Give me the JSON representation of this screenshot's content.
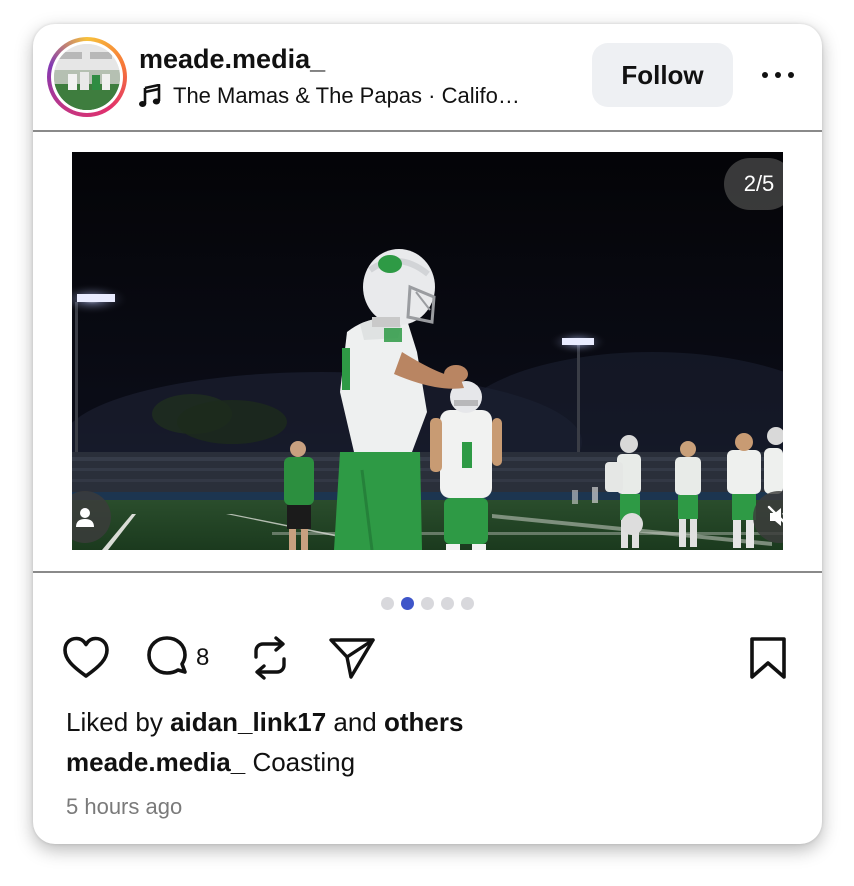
{
  "post": {
    "username": "meade.media_",
    "music_text": "The Mamas & The Papas · Califo…",
    "follow_label": "Follow",
    "media_counter": "2/5",
    "carousel": {
      "total": 5,
      "active_index": 1
    },
    "comment_count": "8",
    "liked_prefix": "Liked by ",
    "liked_user": "aidan_link17",
    "liked_and": " and ",
    "liked_others": "others",
    "caption_user": "meade.media_",
    "caption_text": " Coasting",
    "timestamp": "5 hours ago"
  },
  "icons": {
    "more": "more-horizontal-icon",
    "music": "music-note-icon",
    "user_tag": "user-tag-icon",
    "mute": "muted-speaker-icon",
    "like": "heart-icon",
    "comment": "comment-bubble-icon",
    "repost": "repost-icon",
    "share": "send-icon",
    "save": "bookmark-icon"
  },
  "colors": {
    "follow_bg": "#eef0f3",
    "active_dot": "#3e55c9",
    "inactive_dot": "#d8d8dc",
    "timestamp": "#7a7a7a",
    "jersey_green": "#2e9a45"
  }
}
